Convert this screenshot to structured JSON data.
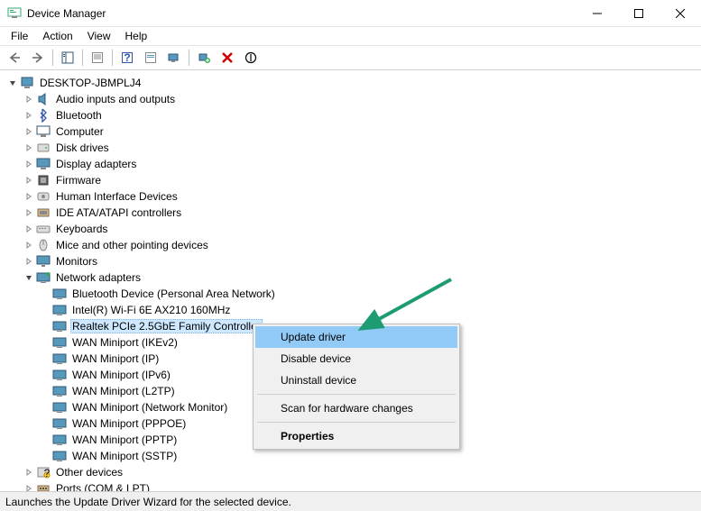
{
  "window": {
    "title": "Device Manager"
  },
  "menubar": [
    "File",
    "Action",
    "View",
    "Help"
  ],
  "root": {
    "label": "DESKTOP-JBMPLJ4"
  },
  "categories": [
    {
      "label": "Audio inputs and outputs",
      "icon": "speaker"
    },
    {
      "label": "Bluetooth",
      "icon": "bluetooth"
    },
    {
      "label": "Computer",
      "icon": "computer"
    },
    {
      "label": "Disk drives",
      "icon": "disk"
    },
    {
      "label": "Display adapters",
      "icon": "display"
    },
    {
      "label": "Firmware",
      "icon": "chip"
    },
    {
      "label": "Human Interface Devices",
      "icon": "hid"
    },
    {
      "label": "IDE ATA/ATAPI controllers",
      "icon": "ide"
    },
    {
      "label": "Keyboards",
      "icon": "keyboard"
    },
    {
      "label": "Mice and other pointing devices",
      "icon": "mouse"
    },
    {
      "label": "Monitors",
      "icon": "monitor"
    }
  ],
  "network": {
    "label": "Network adapters",
    "children": [
      {
        "label": "Bluetooth Device (Personal Area Network)"
      },
      {
        "label": "Intel(R) Wi-Fi 6E AX210 160MHz"
      },
      {
        "label": "Realtek PCIe 2.5GbE Family Controller",
        "selected": true
      },
      {
        "label": "WAN Miniport (IKEv2)"
      },
      {
        "label": "WAN Miniport (IP)"
      },
      {
        "label": "WAN Miniport (IPv6)"
      },
      {
        "label": "WAN Miniport (L2TP)"
      },
      {
        "label": "WAN Miniport (Network Monitor)"
      },
      {
        "label": "WAN Miniport (PPPOE)"
      },
      {
        "label": "WAN Miniport (PPTP)"
      },
      {
        "label": "WAN Miniport (SSTP)"
      }
    ]
  },
  "after": [
    {
      "label": "Other devices",
      "icon": "other"
    },
    {
      "label": "Ports (COM & LPT)",
      "icon": "port",
      "cutoff": true
    }
  ],
  "context_menu": [
    {
      "label": "Update driver",
      "highlight": true
    },
    {
      "label": "Disable device"
    },
    {
      "label": "Uninstall device"
    },
    {
      "sep": true
    },
    {
      "label": "Scan for hardware changes"
    },
    {
      "sep": true
    },
    {
      "label": "Properties",
      "bold": true
    }
  ],
  "statusbar": "Launches the Update Driver Wizard for the selected device.",
  "colors": {
    "highlight": "#91c9f7",
    "selection": "#cde8ff",
    "arrow": "#1d9c73"
  }
}
